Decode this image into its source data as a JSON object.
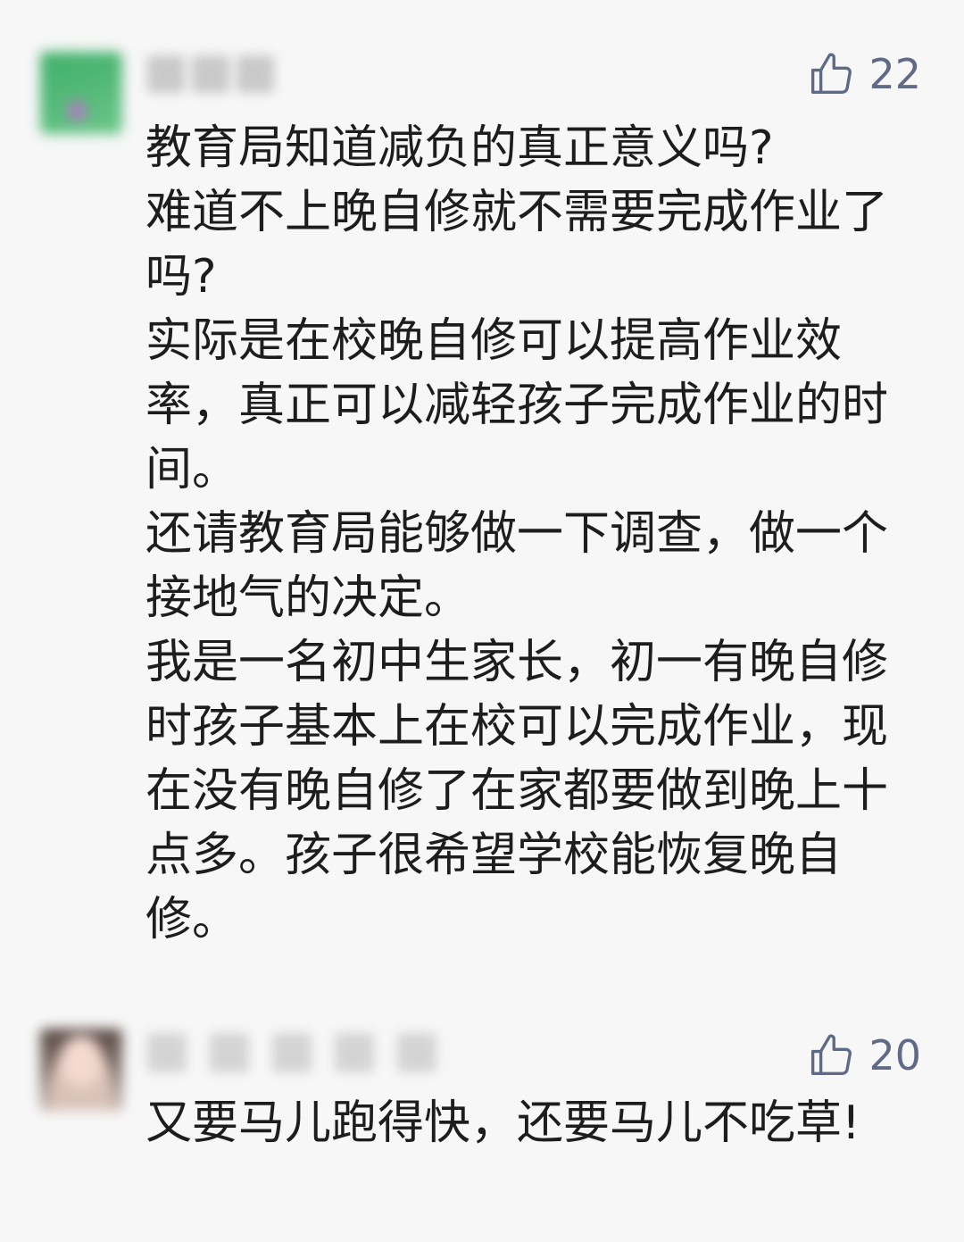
{
  "comments": [
    {
      "likes": "22",
      "lines": [
        "教育局知道减负的真正意义吗?",
        "难道不上晚自修就不需要完成作业了吗?",
        "实际是在校晚自修可以提高作业效率，真正可以减轻孩子完成作业的时间。",
        "还请教育局能够做一下调查，做一个接地气的决定。",
        "我是一名初中生家长，初一有晚自修时孩子基本上在校可以完成作业，现在没有晚自修了在家都要做到晚上十点多。孩子很希望学校能恢复晚自修。"
      ]
    },
    {
      "likes": "20",
      "lines": [
        "又要马儿跑得快，还要马儿不吃草!"
      ]
    }
  ],
  "icons": {
    "like": "thumbs-up-icon"
  },
  "colors": {
    "like": "#5f6a86",
    "text": "#1d1d1d",
    "background": "#f7f7f7"
  }
}
